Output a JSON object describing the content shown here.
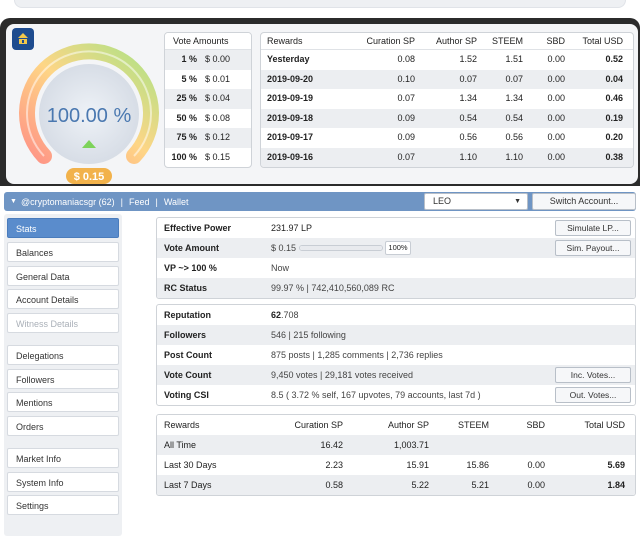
{
  "gauge": {
    "percent_text": "100.00 %",
    "value_text": "$ 0.15",
    "level": 1.0
  },
  "vote_amounts": {
    "header": "Vote Amounts",
    "rows": [
      {
        "pct": "1 %",
        "amt": "$ 0.00"
      },
      {
        "pct": "5 %",
        "amt": "$ 0.01"
      },
      {
        "pct": "25 %",
        "amt": "$ 0.04"
      },
      {
        "pct": "50 %",
        "amt": "$ 0.08"
      },
      {
        "pct": "75 %",
        "amt": "$ 0.12"
      },
      {
        "pct": "100 %",
        "amt": "$ 0.15"
      }
    ]
  },
  "rewards_daily": {
    "headers": [
      "Rewards",
      "Curation SP",
      "Author SP",
      "STEEM",
      "SBD",
      "Total USD"
    ],
    "rows": [
      [
        "Yesterday",
        "0.08",
        "1.52",
        "1.51",
        "0.00",
        "0.52"
      ],
      [
        "2019-09-20",
        "0.10",
        "0.07",
        "0.07",
        "0.00",
        "0.04"
      ],
      [
        "2019-09-19",
        "0.07",
        "1.34",
        "1.34",
        "0.00",
        "0.46"
      ],
      [
        "2019-09-18",
        "0.09",
        "0.54",
        "0.54",
        "0.00",
        "0.19"
      ],
      [
        "2019-09-17",
        "0.09",
        "0.56",
        "0.56",
        "0.00",
        "0.20"
      ],
      [
        "2019-09-16",
        "0.07",
        "1.10",
        "1.10",
        "0.00",
        "0.38"
      ]
    ]
  },
  "navbar": {
    "account": "@cryptomaniacsgr (62)",
    "feed": "Feed",
    "wallet": "Wallet",
    "token_select": "LEO",
    "switch_label": "Switch Account..."
  },
  "sidebar": {
    "items": [
      "Stats",
      "Balances",
      "General Data",
      "Account Details",
      "Witness Details",
      "Delegations",
      "Followers",
      "Mentions",
      "Orders",
      "Market Info",
      "System Info",
      "Settings"
    ]
  },
  "stats": {
    "effective_power_label": "Effective Power",
    "effective_power": "231.97 LP",
    "simulate_label": "Simulate LP...",
    "vote_amount_label": "Vote Amount",
    "vote_amount": "$ 0.15",
    "vote_pct": "100%",
    "vote_level": 1.0,
    "sim_payout_label": "Sim. Payout...",
    "vp_label": "VP ~> 100 %",
    "vp_value": "Now",
    "rc_label": "RC Status",
    "rc_pct": "99.97 %",
    "rc_value": "742,410,560,089 RC"
  },
  "profile": {
    "reputation_label": "Reputation",
    "reputation_int": "62",
    "reputation_dec": ".708",
    "followers_label": "Followers",
    "followers": "546",
    "following": "215 following",
    "post_count_label": "Post Count",
    "posts": "875 posts",
    "comments": "1,285 comments",
    "replies": "2,736 replies",
    "vote_count_label": "Vote Count",
    "votes": "9,450 votes",
    "votes_received": "29,181 votes received",
    "inc_votes_label": "Inc. Votes...",
    "voting_csi_label": "Voting CSI",
    "voting_csi": "8.5 ( 3.72 % self, 167 upvotes, 79 accounts, last 7d )",
    "out_votes_label": "Out. Votes..."
  },
  "rewards_summary": {
    "headers": [
      "Rewards",
      "Curation SP",
      "Author SP",
      "STEEM",
      "SBD",
      "Total USD"
    ],
    "rows": [
      [
        "All Time",
        "16.42",
        "1,003.71",
        "",
        "",
        ""
      ],
      [
        "Last 30 Days",
        "2.23",
        "15.91",
        "15.86",
        "0.00",
        "5.69"
      ],
      [
        "Last 7 Days",
        "0.58",
        "5.22",
        "5.21",
        "0.00",
        "1.84"
      ]
    ]
  },
  "colors": {
    "nav_blue": "#6f95c4",
    "active_blue": "#5a8ccc",
    "gauge_green": "#7dd35a",
    "gauge_text": "#4a78b0"
  }
}
